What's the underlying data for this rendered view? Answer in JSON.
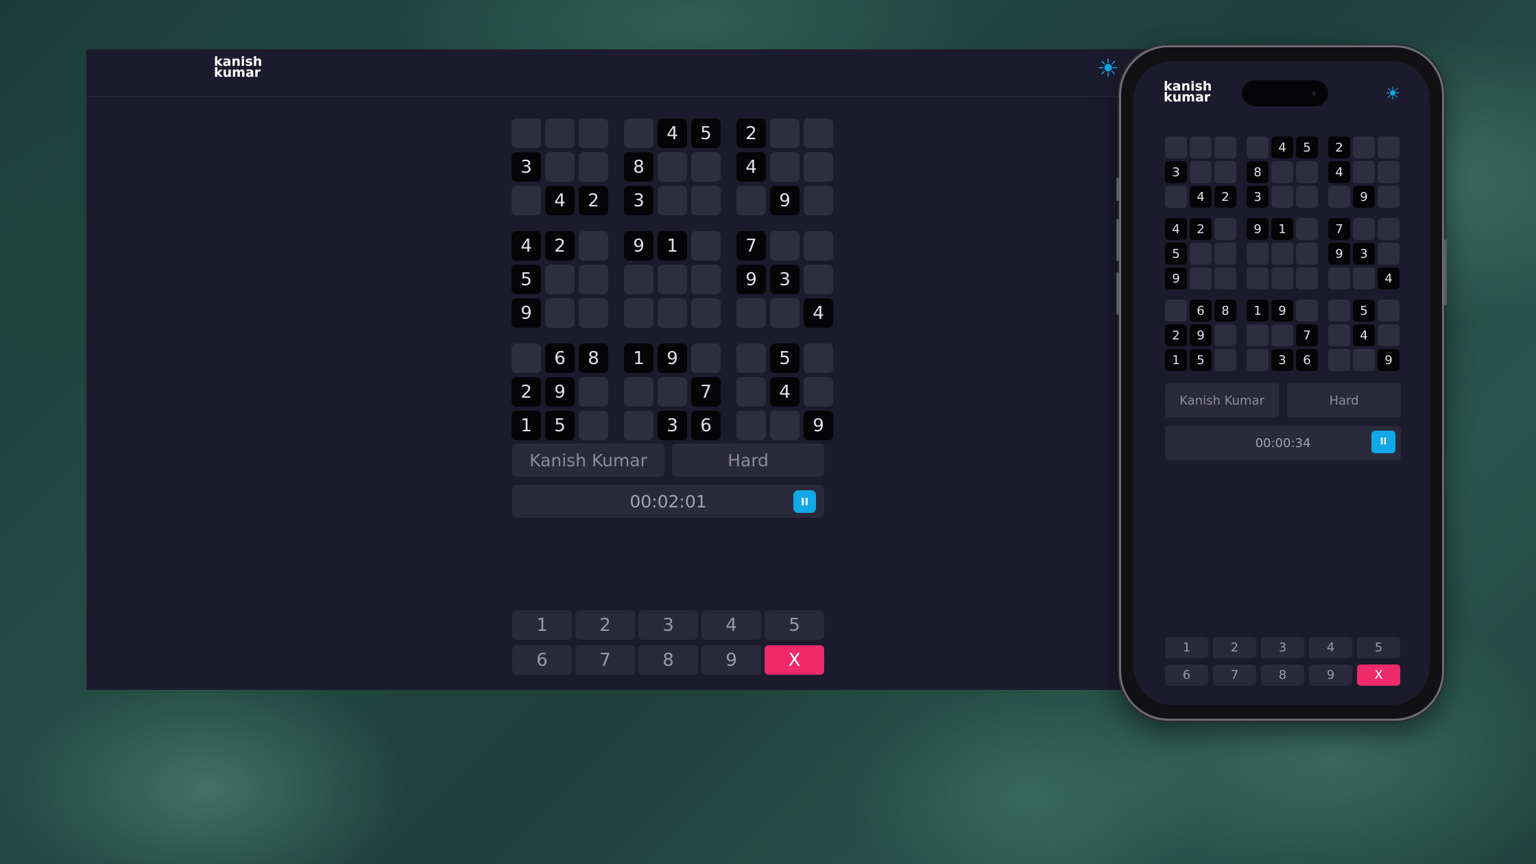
{
  "app": {
    "logo_line1": "kanish",
    "logo_line2": "kumar",
    "theme_icon": "sun-icon",
    "accent_color": "#10a8e8",
    "erase_color": "#ee2a6b"
  },
  "board": [
    [
      "",
      "",
      "",
      "",
      "4",
      "5",
      "2",
      "",
      ""
    ],
    [
      "3",
      "",
      "",
      "8",
      "",
      "",
      "4",
      "",
      ""
    ],
    [
      "",
      "4",
      "2",
      "3",
      "",
      "",
      "",
      "9",
      ""
    ],
    [
      "4",
      "2",
      "",
      "9",
      "1",
      "",
      "7",
      "",
      ""
    ],
    [
      "5",
      "",
      "",
      "",
      "",
      "",
      "9",
      "3",
      ""
    ],
    [
      "9",
      "",
      "",
      "",
      "",
      "",
      "",
      "",
      "4"
    ],
    [
      "",
      "6",
      "8",
      "1",
      "9",
      "",
      "",
      "5",
      ""
    ],
    [
      "2",
      "9",
      "",
      "",
      "",
      "7",
      "",
      "4",
      ""
    ],
    [
      "1",
      "5",
      "",
      "",
      "3",
      "6",
      "",
      "",
      "9"
    ]
  ],
  "desktop": {
    "player_name": "Kanish Kumar",
    "difficulty": "Hard",
    "timer": "00:02:01"
  },
  "mobile": {
    "player_name": "Kanish Kumar",
    "difficulty": "Hard",
    "timer": "00:00:34"
  },
  "pause_icon": "pause-icon",
  "pause_label": "II",
  "numpad": [
    "1",
    "2",
    "3",
    "4",
    "5",
    "6",
    "7",
    "8",
    "9"
  ],
  "erase_label": "X"
}
